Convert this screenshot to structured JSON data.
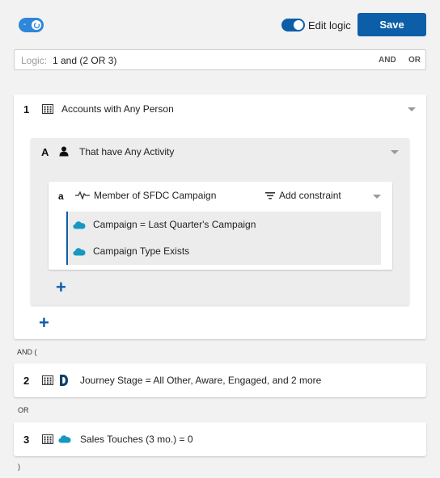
{
  "header": {
    "toggle_dash": "-",
    "edit_logic_label": "Edit logic",
    "save_label": "Save"
  },
  "logic": {
    "label": "Logic:",
    "value": "1 and (2 OR 3)",
    "and_label": "AND",
    "or_label": "OR"
  },
  "filter1": {
    "number": "1",
    "text": "Accounts with  Any  Person",
    "subgroup": {
      "letter": "A",
      "text": "That have  Any  Activity",
      "condition": {
        "letter": "a",
        "title": "Member of SFDC Campaign",
        "add_constraint_label": "Add constraint",
        "constraints": [
          {
            "text": "Campaign  =   Last Quarter's Campaign"
          },
          {
            "text": "Campaign Type  Exists"
          }
        ]
      }
    }
  },
  "connector_and": "AND (",
  "filter2": {
    "number": "2",
    "text": "Journey Stage   =   All Other, Aware, Engaged, and 2 more"
  },
  "connector_or": "OR",
  "filter3": {
    "number": "3",
    "text": "Sales Touches (3 mo.)   =   0"
  },
  "connector_close": ")",
  "colors": {
    "primary": "#0d5ea8",
    "accent": "#2f87d9",
    "salesforce": "#1798c1"
  }
}
